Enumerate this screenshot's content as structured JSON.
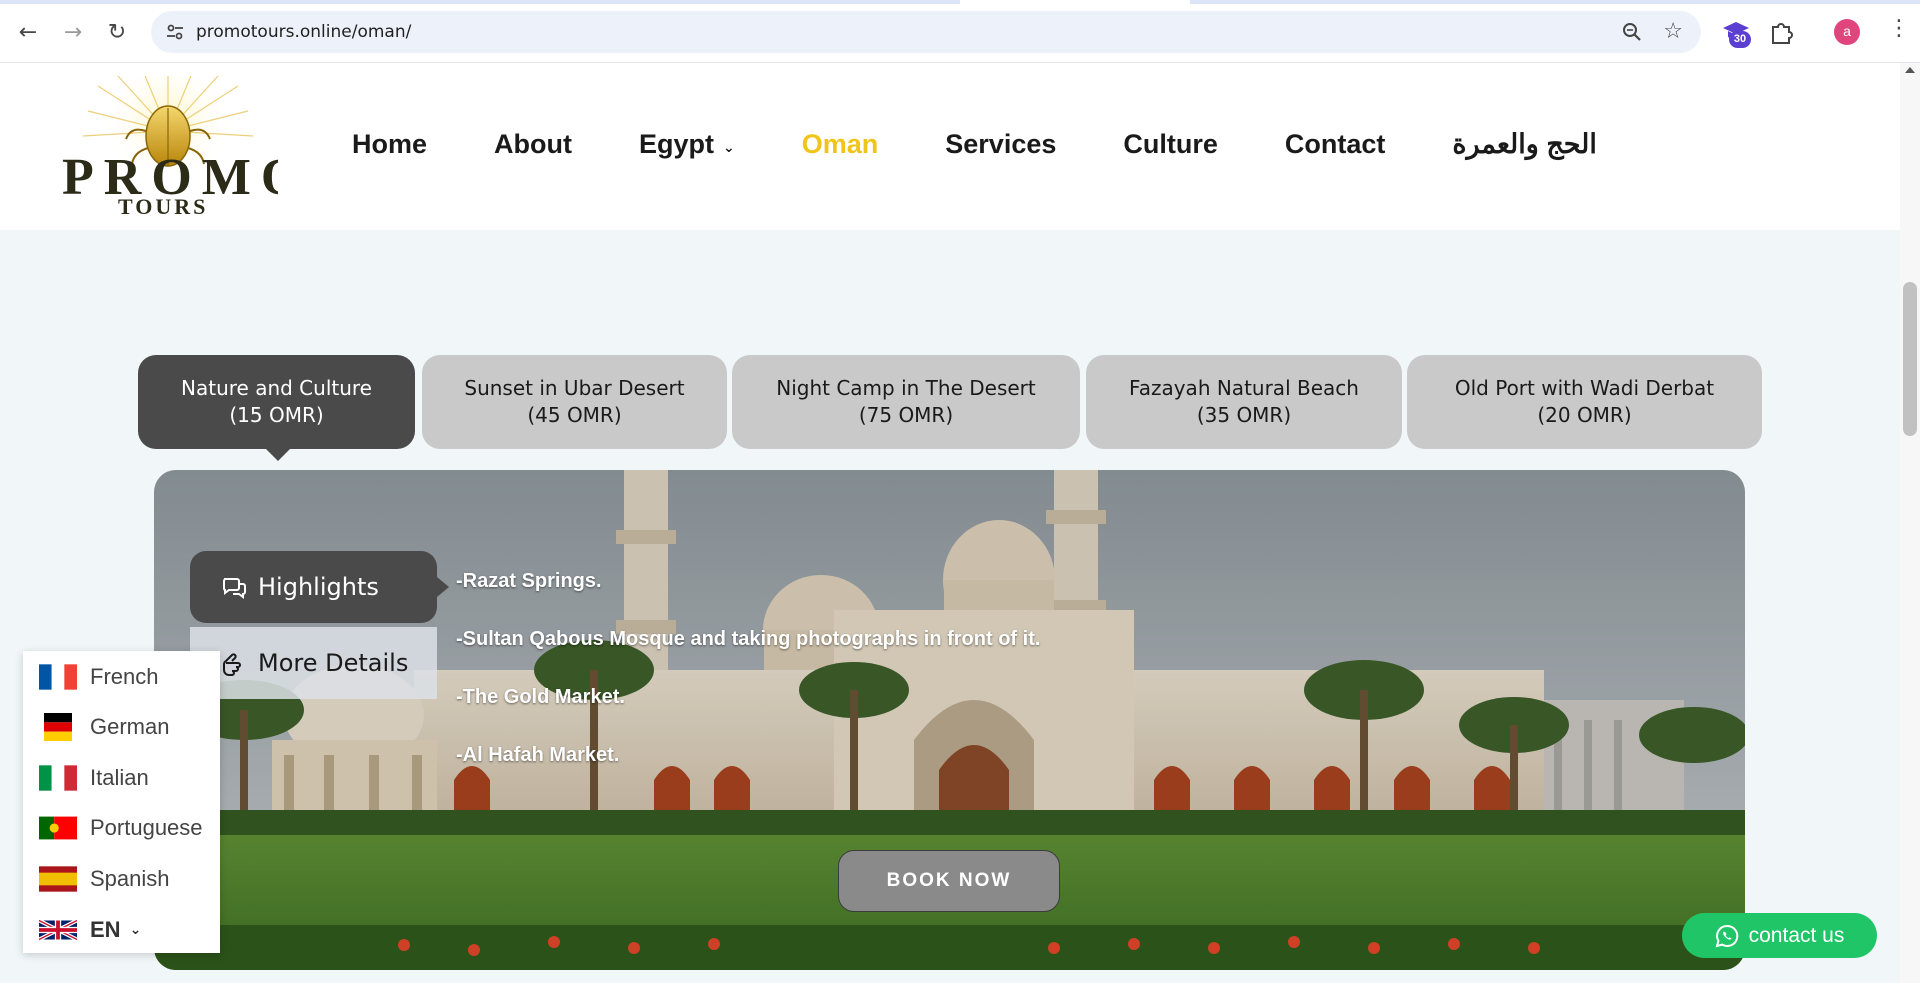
{
  "browser": {
    "url": "promotours.online/oman/",
    "extension_badge": "30",
    "profile_initial": "a"
  },
  "site": {
    "logo_text_top": "PROMO",
    "logo_text_bottom": "TOURS",
    "nav": [
      {
        "label": "Home"
      },
      {
        "label": "About"
      },
      {
        "label": "Egypt",
        "has_dropdown": true
      },
      {
        "label": "Oman",
        "active": true
      },
      {
        "label": "Services"
      },
      {
        "label": "Culture"
      },
      {
        "label": "Contact"
      },
      {
        "label": "الحج والعمرة"
      }
    ],
    "active_color": "#f0c419"
  },
  "tabs": [
    {
      "line1": "Nature and Culture",
      "line2": "(15 OMR)",
      "active": true
    },
    {
      "line1": "Sunset in Ubar Desert",
      "line2": "(45 OMR)"
    },
    {
      "line1": "Night Camp in The Desert",
      "line2": "(75 OMR)"
    },
    {
      "line1": "Fazayah Natural Beach",
      "line2": "(35 OMR)"
    },
    {
      "line1": "Old Port with Wadi Derbat",
      "line2": "(20 OMR)"
    }
  ],
  "hero": {
    "side_tabs": {
      "highlights": "Highlights",
      "details": "More Details"
    },
    "highlights": [
      "-Razat Springs.",
      "-Sultan Qabous Mosque and taking photographs in front of it.",
      "-The Gold Market.",
      "-Al Hafah Market."
    ],
    "book_label": "BOOK NOW"
  },
  "languages": {
    "options": [
      "French",
      "German",
      "Italian",
      "Portuguese",
      "Spanish"
    ],
    "current": "EN"
  },
  "contact": {
    "label": "contact us",
    "color": "#20c567"
  }
}
